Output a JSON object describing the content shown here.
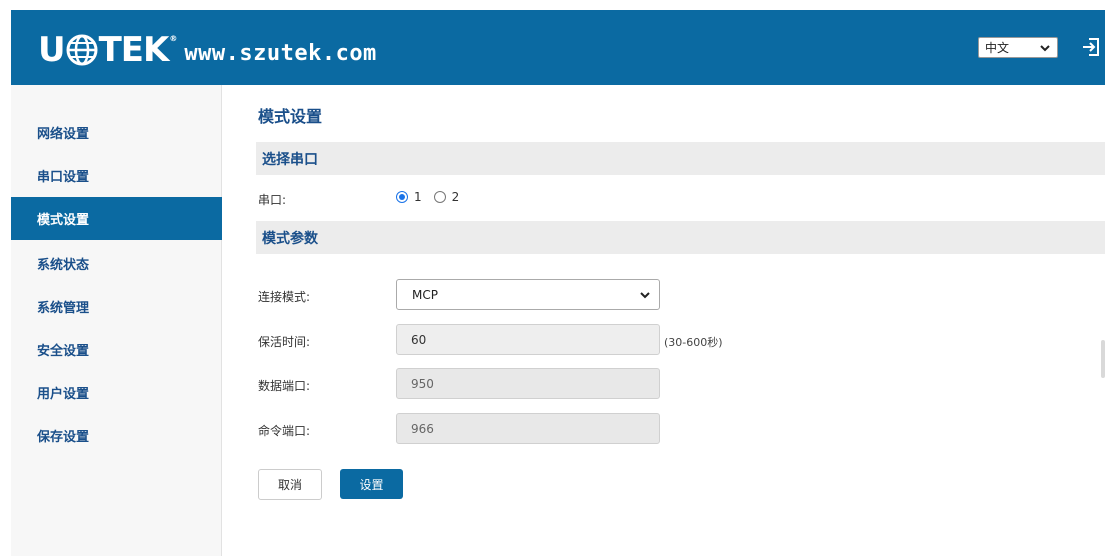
{
  "header": {
    "logo_left": "U",
    "logo_right": "TEK",
    "logo_reg": "®",
    "url": "www.szutek.com",
    "language": "中文",
    "logout_icon": "logout-icon"
  },
  "colors": {
    "brand": "#0b6aa2",
    "title": "#1a4f8a",
    "radio": "#1a73e8"
  },
  "sidebar": {
    "items": [
      {
        "label": "网络设置"
      },
      {
        "label": "串口设置"
      },
      {
        "label": "模式设置"
      },
      {
        "label": "系统状态"
      },
      {
        "label": "系统管理"
      },
      {
        "label": "安全设置"
      },
      {
        "label": "用户设置"
      },
      {
        "label": "保存设置"
      }
    ],
    "active": "模式设置"
  },
  "main": {
    "title": "模式设置",
    "section_serial": "选择串口",
    "serial_label": "串口:",
    "serial_options": [
      "1",
      "2"
    ],
    "serial_selected": "1",
    "section_params": "模式参数",
    "mode_label": "连接模式:",
    "mode_value": "MCP",
    "keepalive_label": "保活时间:",
    "keepalive_value": "60",
    "keepalive_hint": "(30-600秒)",
    "data_port_label": "数据端口:",
    "data_port_value": "950",
    "cmd_port_label": "命令端口:",
    "cmd_port_value": "966",
    "cancel_label": "取消",
    "save_label": "设置"
  }
}
